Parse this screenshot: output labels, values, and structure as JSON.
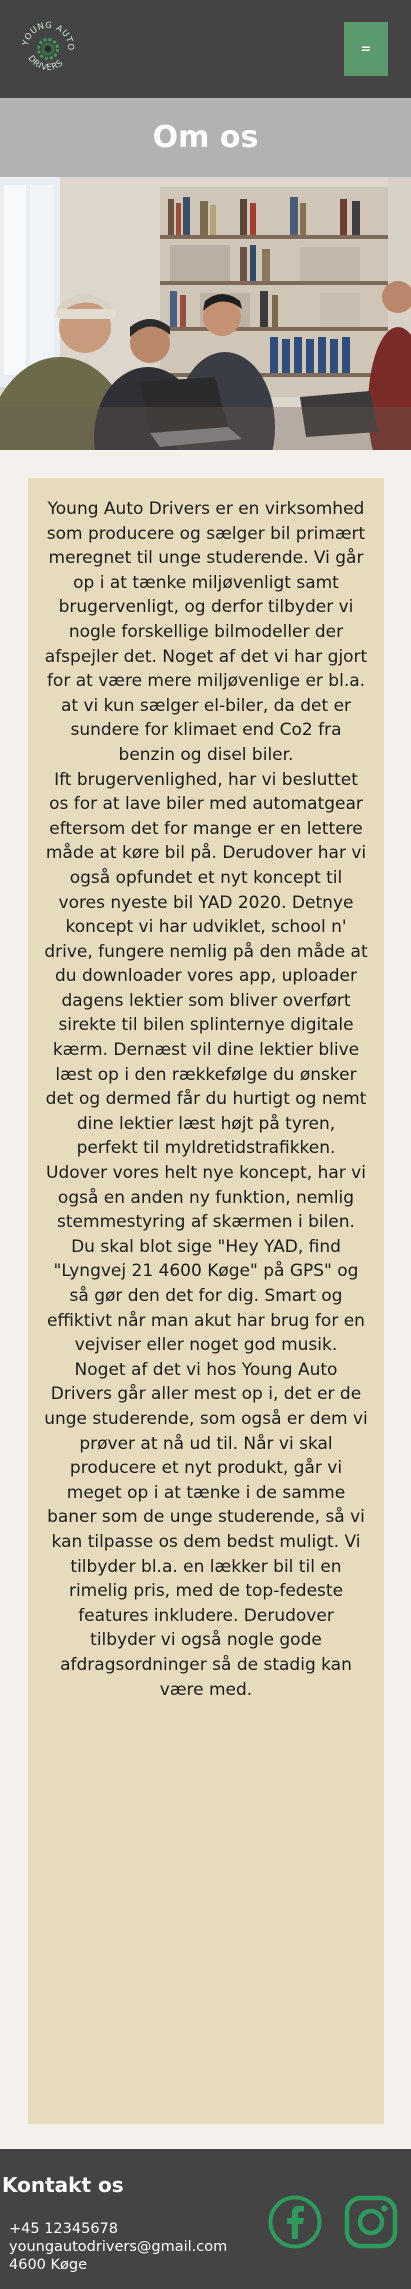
{
  "header": {
    "logo_text": "YOUNG AUTO DRIVERS",
    "menu_label": "=",
    "accent_color": "#5a9a6e",
    "background_color": "#444444"
  },
  "page": {
    "title": "Om os"
  },
  "hero": {
    "icon": "hero-photo"
  },
  "about": {
    "text": "Young Auto Drivers er en virksomhed som producere og sælger bil primært meregnet til unge studerende. Vi går op i at tænke miljøvenligt samt brugervenligt, og derfor tilbyder vi nogle forskellige bilmodeller der afspejler det. Noget af det vi har gjort for at være mere miljøvenlige er bl.a. at vi kun sælger el-biler, da det er sundere for klimaet end Co2 fra benzin og disel biler.\nIft brugervenlighed, har vi besluttet os for at lave biler med automatgear eftersom det for mange er en lettere måde at køre bil på. Derudover har vi også opfundet et nyt koncept til vores nyeste bil YAD 2020. Detnye koncept vi har udviklet, school n' drive, fungere nemlig på den måde at du downloader vores app, uploader dagens lektier som bliver overført sirekte til bilen splinternye digitale kærm. Dernæst vil dine lektier blive læst op i den rækkefølge du ønsker det og dermed får du hurtigt og nemt dine lektier læst højt på tyren, perfekt til myldretidstrafikken.\nUdover vores helt nye koncept, har vi også en anden ny funktion, nemlig stemmestyring af skærmen i bilen. Du skal blot sige \"Hey YAD, find \"Lyngvej 21 4600 Køge\" på GPS\" og så gør den det for dig. Smart og effiktivt når man akut har brug for en vejviser eller noget god musik.\nNoget af det vi hos Young Auto Drivers går aller mest op i, det er de unge studerende, som også er dem vi prøver at nå ud til. Når vi skal producere et nyt produkt, går vi meget op i at tænke i de samme baner som de unge studerende, så vi kan tilpasse os dem bedst muligt. Vi tilbyder bl.a. en lækker bil til en rimelig pris, med de top-fedeste features inkludere. Derudover tilbyder vi også nogle gode afdragsordninger så de stadig kan være med.",
    "card_color": "#e6dbbd"
  },
  "footer": {
    "title": "Kontakt os",
    "phone": "+45 12345678",
    "email": "youngautodrivers@gmail.com",
    "city": "4600 Køge",
    "social": [
      {
        "icon": "facebook-icon",
        "color": "#2e9a5e"
      },
      {
        "icon": "instagram-icon",
        "color": "#2e9a5e"
      }
    ]
  }
}
